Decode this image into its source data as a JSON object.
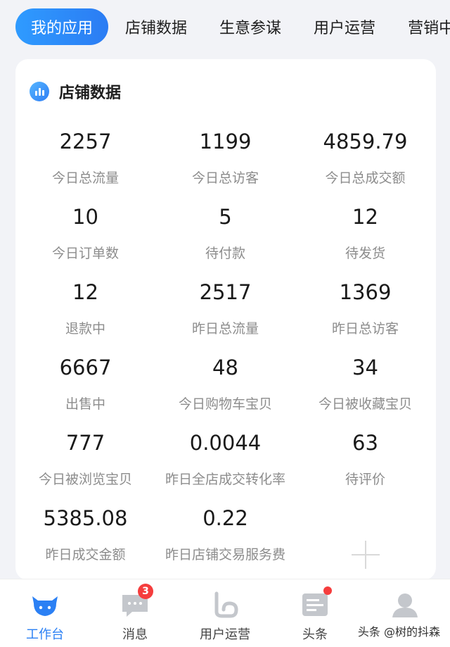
{
  "tabs": [
    {
      "label": "我的应用",
      "active": true
    },
    {
      "label": "店铺数据"
    },
    {
      "label": "生意参谋"
    },
    {
      "label": "用户运营"
    },
    {
      "label": "营销中"
    }
  ],
  "card": {
    "title": "店铺数据",
    "icon": "bar-chart-icon",
    "metrics": [
      {
        "value": "2257",
        "label": "今日总流量"
      },
      {
        "value": "1199",
        "label": "今日总访客"
      },
      {
        "value": "4859.79",
        "label": "今日总成交额"
      },
      {
        "value": "10",
        "label": "今日订单数"
      },
      {
        "value": "5",
        "label": "待付款"
      },
      {
        "value": "12",
        "label": "待发货"
      },
      {
        "value": "12",
        "label": "退款中"
      },
      {
        "value": "2517",
        "label": "昨日总流量"
      },
      {
        "value": "1369",
        "label": "昨日总访客"
      },
      {
        "value": "6667",
        "label": "出售中"
      },
      {
        "value": "48",
        "label": "今日购物车宝贝"
      },
      {
        "value": "34",
        "label": "今日被收藏宝贝"
      },
      {
        "value": "777",
        "label": "今日被浏览宝贝"
      },
      {
        "value": "0.0044",
        "label": "昨日全店成交转化率"
      },
      {
        "value": "63",
        "label": "待评价"
      },
      {
        "value": "5385.08",
        "label": "昨日成交金额"
      },
      {
        "value": "0.22",
        "label": "昨日店铺交易服务费"
      }
    ]
  },
  "bottom_nav": [
    {
      "label": "工作台",
      "icon": "cow-icon",
      "active": true
    },
    {
      "label": "消息",
      "icon": "message-icon",
      "badge": "3"
    },
    {
      "label": "用户运营",
      "icon": "user-ops-icon"
    },
    {
      "label": "头条",
      "icon": "news-icon",
      "dot": true
    },
    {
      "label": "",
      "icon": "profile-icon"
    }
  ],
  "watermark": "头条 @树的抖森",
  "colors": {
    "accent": "#2b80f4",
    "badge": "#f53d3d"
  }
}
